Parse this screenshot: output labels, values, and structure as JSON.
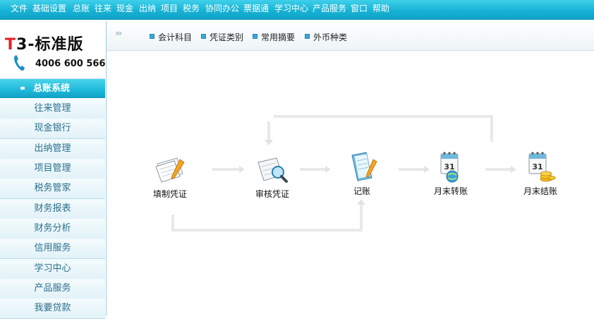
{
  "menu": {
    "items": [
      "文件",
      "基础设置",
      "总账",
      "往来",
      "现金",
      "出纳",
      "项目",
      "税务",
      "协同办公",
      "票据通",
      "学习中心",
      "产品服务",
      "窗口",
      "帮助"
    ]
  },
  "logo": {
    "brand_t": "T",
    "brand_rest": "3-标准版",
    "phone": "4006 600 566"
  },
  "nav": {
    "header": "总账系统",
    "items": [
      "往来管理",
      "现金银行",
      "出纳管理",
      "项目管理",
      "税务管家",
      "财务报表",
      "财务分析",
      "信用服务",
      "学习中心",
      "产品服务",
      "我要贷款"
    ]
  },
  "tabs": {
    "arrows": "›››",
    "items": [
      "会计科目",
      "凭证类别",
      "常用摘要",
      "外币种类"
    ]
  },
  "flow": {
    "nodes": [
      "填制凭证",
      "审核凭证",
      "记账",
      "月末转账",
      "月末结账"
    ]
  },
  "colors": {
    "menubar": "#17b3d6",
    "nav_text": "#2a6f8e",
    "accent": "#3aa6d6"
  }
}
